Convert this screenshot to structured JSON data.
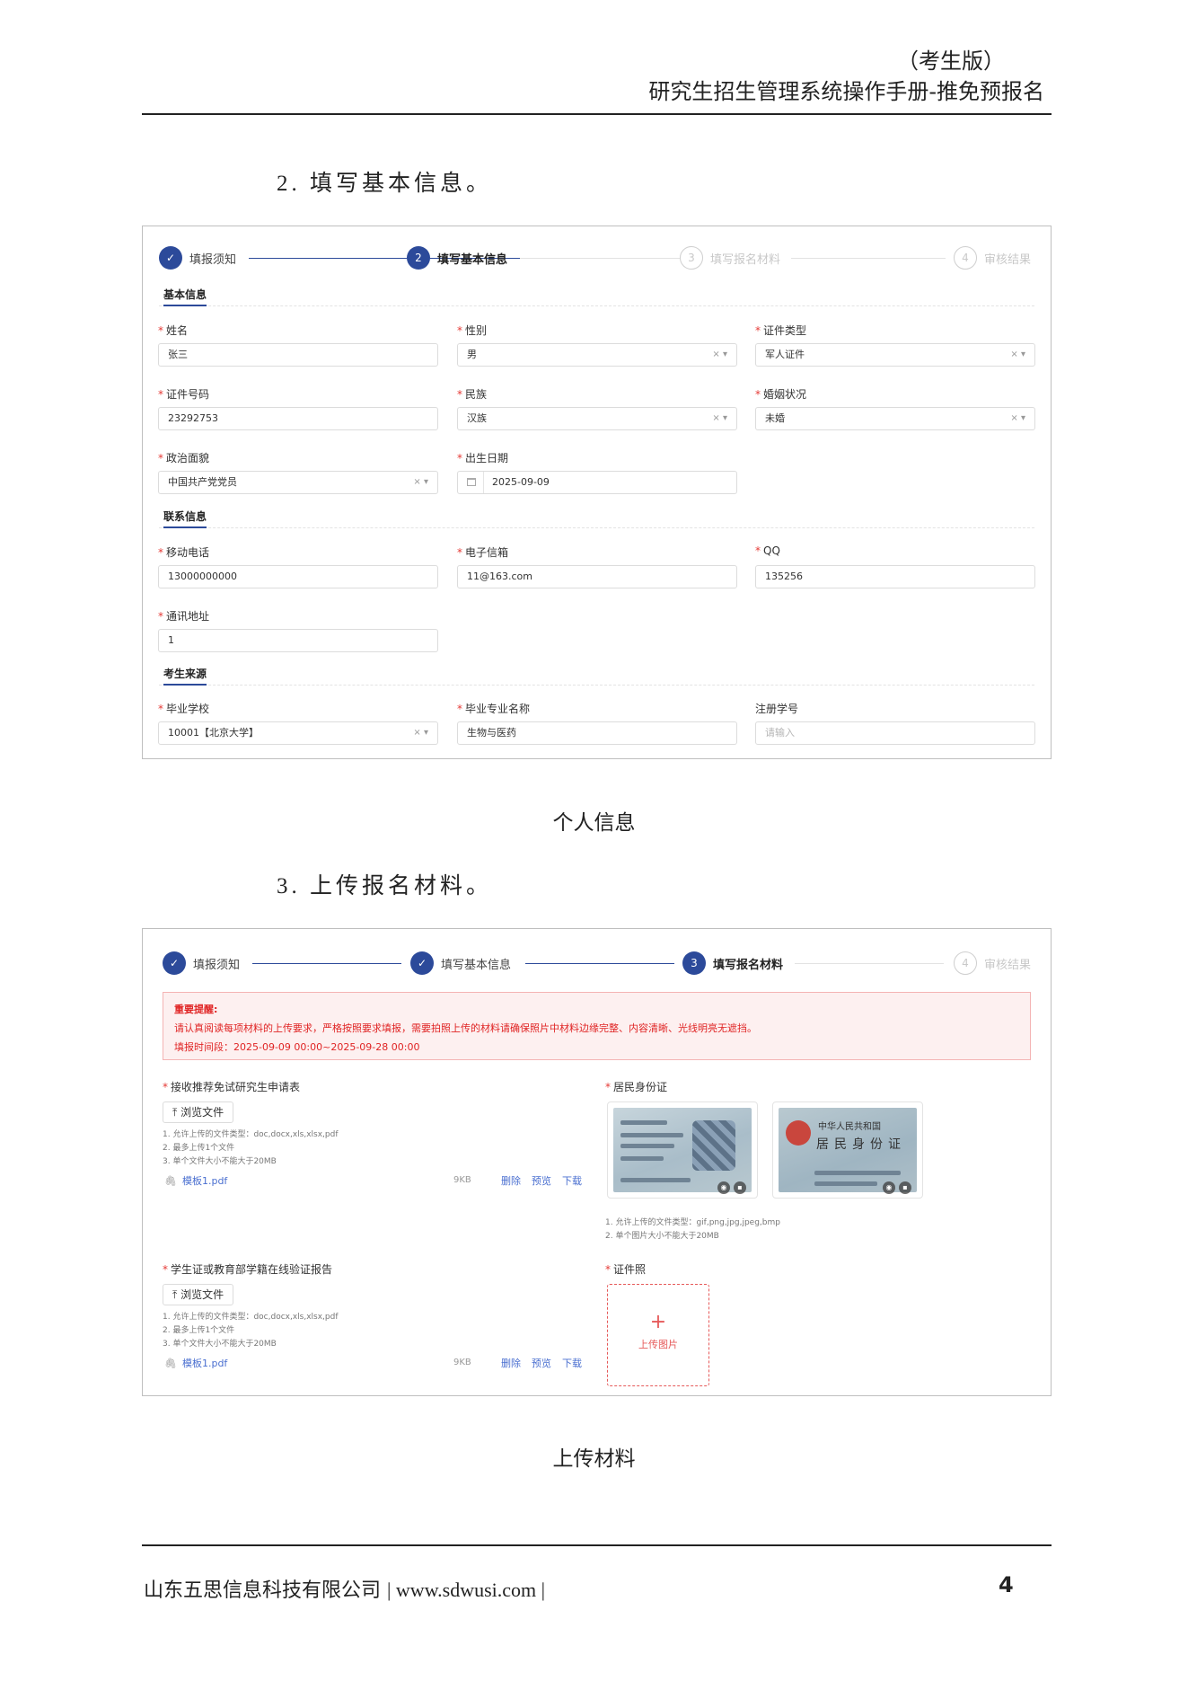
{
  "header": {
    "subtitle": "（考生版）",
    "title": "研究生招生管理系统操作手册-推免预报名"
  },
  "section2": {
    "heading": "2.  填写基本信息。",
    "caption": "个人信息",
    "steps": [
      "填报须知",
      "填写基本信息",
      "填写报名材料",
      "审核结果"
    ],
    "step_numbers": [
      "",
      "2",
      "3",
      "4"
    ],
    "sections": {
      "basic": "基本信息",
      "contact": "联系信息",
      "source": "考生来源"
    },
    "fields": {
      "name": {
        "label": "姓名",
        "value": "张三"
      },
      "gender": {
        "label": "性别",
        "value": "男"
      },
      "id_type": {
        "label": "证件类型",
        "value": "军人证件"
      },
      "id_number": {
        "label": "证件号码",
        "value": "23292753"
      },
      "ethnicity": {
        "label": "民族",
        "value": "汉族"
      },
      "marital": {
        "label": "婚姻状况",
        "value": "未婚"
      },
      "political": {
        "label": "政治面貌",
        "value": "中国共产党党员"
      },
      "birth_date": {
        "label": "出生日期",
        "value": "2025-09-09"
      },
      "mobile": {
        "label": "移动电话",
        "value": "13000000000"
      },
      "email": {
        "label": "电子信箱",
        "value": "11@163.com"
      },
      "qq": {
        "label": "QQ",
        "value": "135256"
      },
      "address": {
        "label": "通讯地址",
        "value": "1"
      },
      "school": {
        "label": "毕业学校",
        "value": "10001【北京大学】"
      },
      "major": {
        "label": "毕业专业名称",
        "value": "生物与医药"
      },
      "reg_no": {
        "label": "注册学号",
        "placeholder": "请输入"
      }
    }
  },
  "section3": {
    "heading": "3.  上传报名材料。",
    "caption": "上传材料",
    "steps": [
      "填报须知",
      "填写基本信息",
      "填写报名材料",
      "审核结果"
    ],
    "step_numbers": [
      "",
      "",
      "3",
      "4"
    ],
    "alert": {
      "title": "重要提醒:",
      "line1": "请认真阅读每项材料的上传要求，严格按照要求填报，需要拍照上传的材料请确保照片中材料边缘完整、内容清晰、光线明亮无遮挡。",
      "line2": "填报时间段：2025-09-09 00:00~2025-09-28 00:00"
    },
    "doc_hint": [
      "1. 允许上传的文件类型：doc,docx,xls,xlsx,pdf",
      "2. 最多上传1个文件",
      "3. 单个文件大小不能大于20MB"
    ],
    "img_hint": [
      "1. 允许上传的文件类型：gif,png,jpg,jpeg,bmp",
      "2. 单个图片大小不能大于20MB"
    ],
    "browse_label": "浏览文件",
    "file_actions": [
      "删除",
      "预览",
      "下载"
    ],
    "materials": {
      "application": {
        "label": "接收推荐免试研究生申请表",
        "file": "模板1.pdf",
        "size": "9KB"
      },
      "student_card": {
        "label": "学生证或教育部学籍在线验证报告",
        "file": "模板1.pdf",
        "size": "9KB"
      },
      "id_card": {
        "label": "居民身份证",
        "back_title": "中华人民共和国",
        "back_big": "居民身份证"
      },
      "photo": {
        "label": "证件照",
        "upload_label": "上传图片"
      }
    }
  },
  "footer": {
    "company": "山东五思信息科技有限公司",
    "url": "| www.sdwusi.com |",
    "page": "4"
  }
}
